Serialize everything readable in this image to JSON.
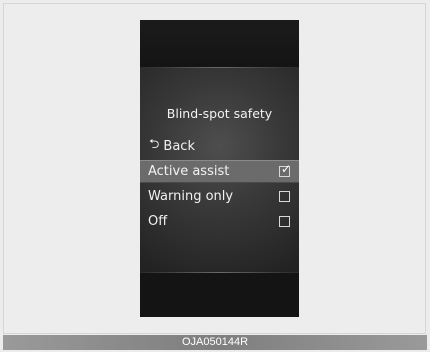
{
  "menu": {
    "title": "Blind-spot safety",
    "back_label": "Back",
    "back_icon": "return-arrow-icon",
    "options": [
      {
        "label": "Active assist",
        "checked": true,
        "selected": true
      },
      {
        "label": "Warning only",
        "checked": false,
        "selected": false
      },
      {
        "label": "Off",
        "checked": false,
        "selected": false
      }
    ]
  },
  "figure_code": "OJA050144R",
  "colors": {
    "screen_background": "#171717",
    "panel_center": "#4e4e4e",
    "selected_row": "#6b6b6b",
    "text": "#f2f2f2",
    "footer_bar": "#8a8a8a"
  }
}
